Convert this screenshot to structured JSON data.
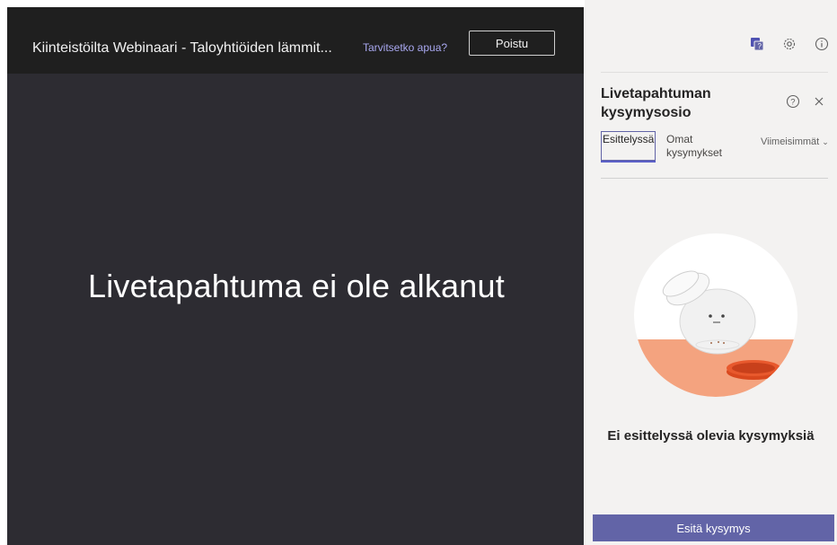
{
  "stage": {
    "event_title": "Kiinteistöilta Webinaari - Taloyhtiöiden lämmit...",
    "help_link": "Tarvitsetko apua?",
    "leave_button": "Poistu",
    "status_message": "Livetapahtuma ei ole alkanut"
  },
  "panel": {
    "icons": [
      "qna-icon",
      "gear-icon",
      "info-icon"
    ],
    "title": "Livetapahtuman kysymysosio",
    "tabs": [
      {
        "label": "Esittelyssä",
        "selected": true
      },
      {
        "label": "Omat kysymykset",
        "selected": false
      }
    ],
    "sort_label": "Viimeisimmät",
    "empty_message": "Ei esittelyssä olevia kysymyksiä",
    "ask_button": "Esitä kysymys"
  },
  "colors": {
    "stage_bg": "#2d2c32",
    "header_bg": "#1f1f1f",
    "panel_bg": "#f3f2f1",
    "accent": "#6264a7",
    "link": "#a9a8f0"
  }
}
